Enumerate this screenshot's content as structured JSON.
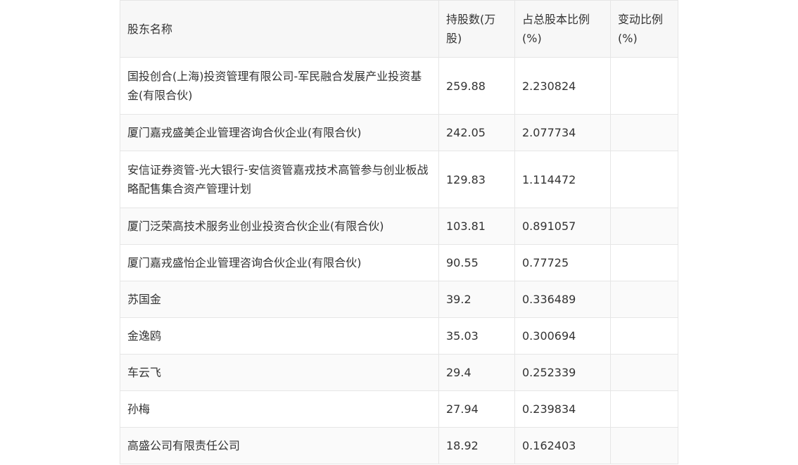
{
  "table": {
    "headers": [
      "股东名称",
      "持股数(万股)",
      "占总股本比例(%)",
      "变动比例(%)"
    ],
    "rows": [
      {
        "name": "国投创合(上海)投资管理有限公司-军民融合发展产业投资基金(有限合伙)",
        "shares": "259.88",
        "ratio": "2.230824",
        "change": ""
      },
      {
        "name": "厦门嘉戎盛美企业管理咨询合伙企业(有限合伙)",
        "shares": "242.05",
        "ratio": "2.077734",
        "change": ""
      },
      {
        "name": "安信证券资管-光大银行-安信资管嘉戎技术高管参与创业板战略配售集合资产管理计划",
        "shares": "129.83",
        "ratio": "1.114472",
        "change": ""
      },
      {
        "name": "厦门泛荣高技术服务业创业投资合伙企业(有限合伙)",
        "shares": "103.81",
        "ratio": "0.891057",
        "change": ""
      },
      {
        "name": "厦门嘉戎盛怡企业管理咨询合伙企业(有限合伙)",
        "shares": "90.55",
        "ratio": "0.77725",
        "change": ""
      },
      {
        "name": "苏国金",
        "shares": "39.2",
        "ratio": "0.336489",
        "change": ""
      },
      {
        "name": "金逸鸥",
        "shares": "35.03",
        "ratio": "0.300694",
        "change": ""
      },
      {
        "name": "车云飞",
        "shares": "29.4",
        "ratio": "0.252339",
        "change": ""
      },
      {
        "name": "孙梅",
        "shares": "27.94",
        "ratio": "0.239834",
        "change": ""
      },
      {
        "name": "高盛公司有限责任公司",
        "shares": "18.92",
        "ratio": "0.162403",
        "change": ""
      }
    ]
  }
}
